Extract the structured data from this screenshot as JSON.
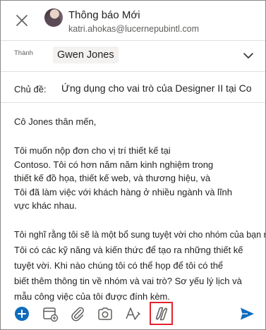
{
  "header": {
    "title": "Thông báo Mới",
    "sender_email": "katri.ahokas@lucernepubintl.com"
  },
  "to": {
    "label": "Thành",
    "recipient": "Gwen Jones"
  },
  "subject": {
    "label": "Chủ đề:",
    "value": "Ứng dụng cho vai trò của Designer II tại Co"
  },
  "body": {
    "greeting": "Cô Jones thân mến,",
    "para1": [
      "Tôi muốn nộp đơn cho vị trí thiết kế tại",
      "Contoso. Tôi có hơn năm năm kinh nghiệm trong",
      "thiết kế đồ họa, thiết kế web, và thương hiệu, và",
      "Tôi đã làm việc với khách hàng ở nhiều ngành và lĩnh",
      "vực khác nhau."
    ],
    "para2_first": "Tôi nghĩ rằng tôi sẽ là một bổ sung tuyệt vời cho nhóm của bạn như",
    "para2": [
      "Tôi có các kỹ năng và kiến thức để tạo ra những thiết kế",
      "tuyệt vời. Khi nào chúng tôi có thể họp để tôi có thể",
      "biết thêm thông tin về nhóm và vai trò? Sơ yếu lý lịch và",
      "mẫu công việc của tôi được đính kèm."
    ]
  },
  "toolbar": {
    "icons": [
      "add-icon",
      "calendar-add-icon",
      "attach-icon",
      "camera-icon",
      "format-text-icon",
      "copilot-icon",
      "send-icon"
    ],
    "accent": "#0f6cbd",
    "highlight_color": "#e3232c"
  }
}
